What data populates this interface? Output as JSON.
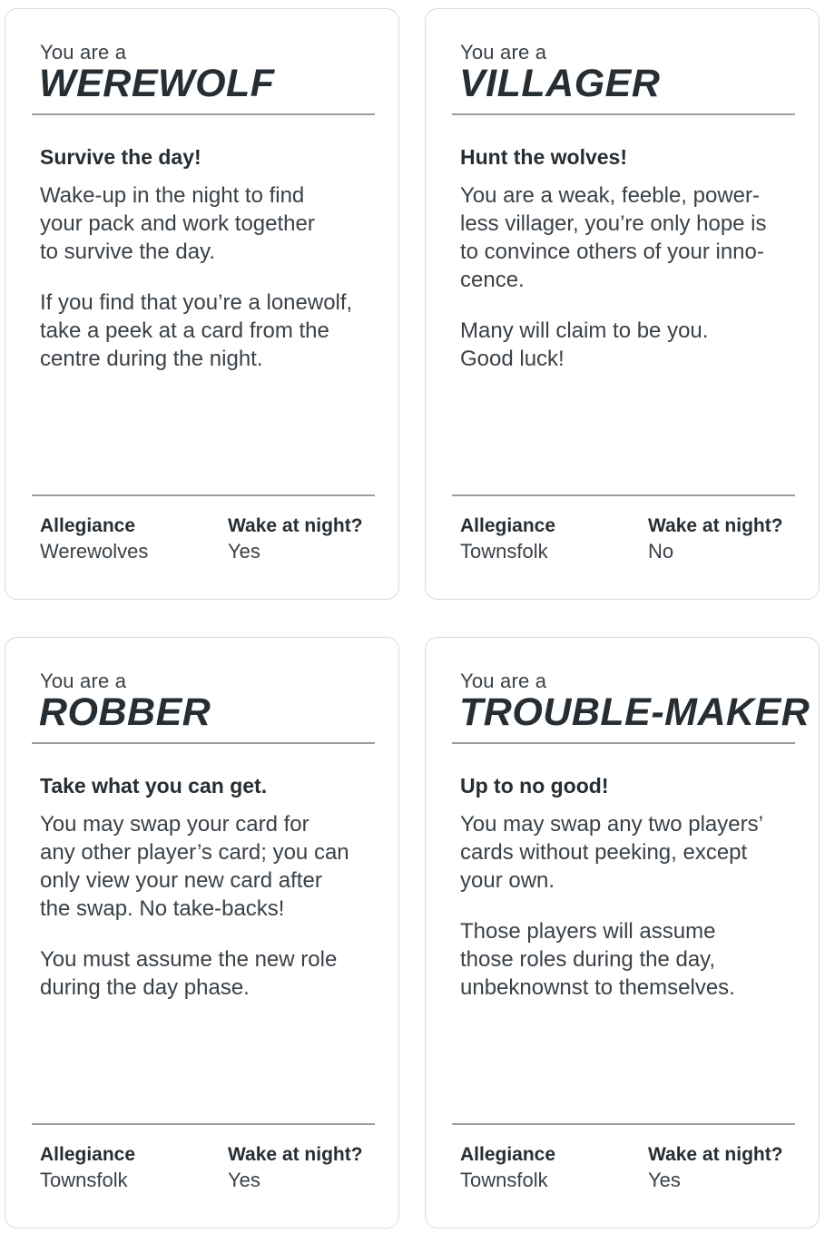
{
  "cards": [
    {
      "prefix": "You are a",
      "role": "WEREWOLF",
      "tagline": "Survive the day!",
      "paragraphs": [
        "Wake-up in the night to find\nyour pack and work together\nto survive the day.",
        "If you find that you’re a lonewolf,\ntake a peek at a card from the\ncentre during the night."
      ],
      "allegiance_label": "Allegiance",
      "allegiance_value": "Werewolves",
      "wake_label": "Wake at night?",
      "wake_value": "Yes"
    },
    {
      "prefix": "You are a",
      "role": "VILLAGER",
      "tagline": "Hunt the wolves!",
      "paragraphs": [
        "You are a weak, feeble, power-\nless villager, you’re only hope is\nto convince others of your inno-\ncence.",
        "Many will claim to be you.\nGood luck!"
      ],
      "allegiance_label": "Allegiance",
      "allegiance_value": "Townsfolk",
      "wake_label": "Wake at night?",
      "wake_value": "No"
    },
    {
      "prefix": "You are a",
      "role": "ROBBER",
      "tagline": "Take what you can get.",
      "paragraphs": [
        "You may swap your card for\nany other player’s card; you can\nonly view your new card after\nthe swap.  No take-backs!",
        "You must assume the new role\nduring the day phase."
      ],
      "allegiance_label": "Allegiance",
      "allegiance_value": "Townsfolk",
      "wake_label": "Wake at night?",
      "wake_value": "Yes"
    },
    {
      "prefix": "You are a",
      "role": "TROUBLE-MAKER",
      "tagline": "Up to no good!",
      "paragraphs": [
        "You may swap any two players’\ncards without peeking, except\nyour own.",
        "Those players will assume\nthose roles during the day,\nunbeknownst to themselves."
      ],
      "allegiance_label": "Allegiance",
      "allegiance_value": "Townsfolk",
      "wake_label": "Wake at night?",
      "wake_value": "Yes"
    }
  ]
}
